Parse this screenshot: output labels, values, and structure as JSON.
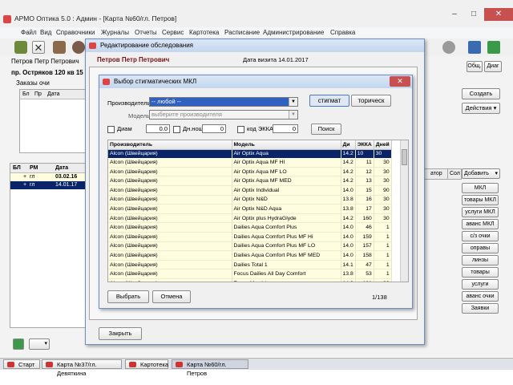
{
  "window": {
    "title": "АРМО Оптика 5.0 : Админ - [Карта №60/гл. Петров]",
    "minimize": "–",
    "maximize": "□",
    "close": "✕"
  },
  "menu": [
    "Файл",
    "Вид",
    "Справочники",
    "Журналы",
    "Отчеты",
    "Сервис",
    "Картотека",
    "Расписание",
    "Администрирование",
    "Справка"
  ],
  "patient": {
    "name": "Петров Петр Петрович",
    "address": "пр. Остряков 120 кв 15"
  },
  "orders_panel": {
    "title": "Заказы очи",
    "headers": [
      "Бл",
      "Пр",
      "Дата"
    ]
  },
  "right_buttons": {
    "create": "Создать",
    "actions": "Действия",
    "general": "Общ.",
    "diag": "Диаг"
  },
  "lower_grid": {
    "headers": [
      "БЛ",
      "РМ",
      "Дата"
    ],
    "rows": [
      {
        "bl": "+",
        "rm": "гл",
        "date": "03.02.16"
      },
      {
        "bl": "+",
        "rm": "гл",
        "date": "14.01.17"
      }
    ]
  },
  "side_panel": {
    "headers": [
      "атор",
      "Сол"
    ],
    "add_button": "Добавить",
    "buttons": [
      "МКЛ",
      "товары МКЛ",
      "услуги МКЛ",
      "аванс МКЛ",
      "с/з очки",
      "оправы",
      "линзы",
      "товары",
      "услуги",
      "аванс очки",
      "Заявки"
    ]
  },
  "exam_dialog": {
    "title": "Редактирование обследования",
    "patient": "Петров Петр Петрович",
    "visit_date": "Дата визита 14.01.2017",
    "close_button": "Закрыть"
  },
  "picker_dialog": {
    "title": "Выбор стигматических МКЛ",
    "manufacturer_label": "Производитель",
    "manufacturer_value": "-- любой --",
    "model_label": "Модель",
    "model_placeholder": "выберите производителя",
    "toggle_stigmatic": "стигмат",
    "toggle_toric": "торичеcк",
    "filter_diam_label": "Диам",
    "filter_diam_value": "0.0",
    "filter_radius_label": "Дн.нош",
    "filter_radius_value": "0",
    "filter_ekka_label": "код ЭККА",
    "filter_ekka_value": "0",
    "search_button": "Поиск",
    "headers": [
      "Производитель",
      "Модель",
      "Ди",
      "ЭККА",
      "Дней"
    ],
    "rows": [
      [
        "Alcon (Швейцария)",
        "Air Optix Aqua",
        "14.2",
        "10",
        "30"
      ],
      [
        "Alcon (Швейцария)",
        "Air Optix Aqua MF HI",
        "14.2",
        "11",
        "30"
      ],
      [
        "Alcon (Швейцария)",
        "Air Optix Aqua MF LO",
        "14.2",
        "12",
        "30"
      ],
      [
        "Alcon (Швейцария)",
        "Air Optix Aqua MF MED",
        "14.2",
        "13",
        "30"
      ],
      [
        "Alcon (Швейцария)",
        "Air Optix Individual",
        "14.0",
        "15",
        "90"
      ],
      [
        "Alcon (Швейцария)",
        "Air Optix N&D",
        "13.8",
        "16",
        "30"
      ],
      [
        "Alcon (Швейцария)",
        "Air Optix N&D Aqua",
        "13.8",
        "17",
        "30"
      ],
      [
        "Alcon (Швейцария)",
        "Air Optix plus HydraGlyde",
        "14.2",
        "160",
        "30"
      ],
      [
        "Alcon (Швейцария)",
        "Dailies Aqua Comfort Plus",
        "14.0",
        "46",
        "1"
      ],
      [
        "Alcon (Швейцария)",
        "Dailies Aqua Comfort Plus MF Hi",
        "14.0",
        "159",
        "1"
      ],
      [
        "Alcon (Швейцария)",
        "Dailies Aqua Comfort Plus MF LO",
        "14.0",
        "157",
        "1"
      ],
      [
        "Alcon (Швейцария)",
        "Dailies Aqua Comfort Plus MF MED",
        "14.0",
        "158",
        "1"
      ],
      [
        "Alcon (Швейцария)",
        "Dailies Total 1",
        "14.1",
        "47",
        "1"
      ],
      [
        "Alcon (Швейцария)",
        "Focus Dailies All Day Comfort",
        "13.8",
        "53",
        "1"
      ],
      [
        "Alcon (Швейцария)",
        "Focus Monthly",
        "14.0",
        "161",
        "30"
      ]
    ],
    "counter": "1/138",
    "select_button": "Выбрать",
    "cancel_button": "Отмена"
  },
  "taskbar": [
    "Старт",
    "Карта №37/гл. Девяткина",
    "Картотека",
    "Карта №60/гл. Петров"
  ],
  "colors": {
    "selection": "#0a246a",
    "row_bg": "#fffde0",
    "dialog_title": "#c3d6ee",
    "close_red": "#c75050"
  }
}
